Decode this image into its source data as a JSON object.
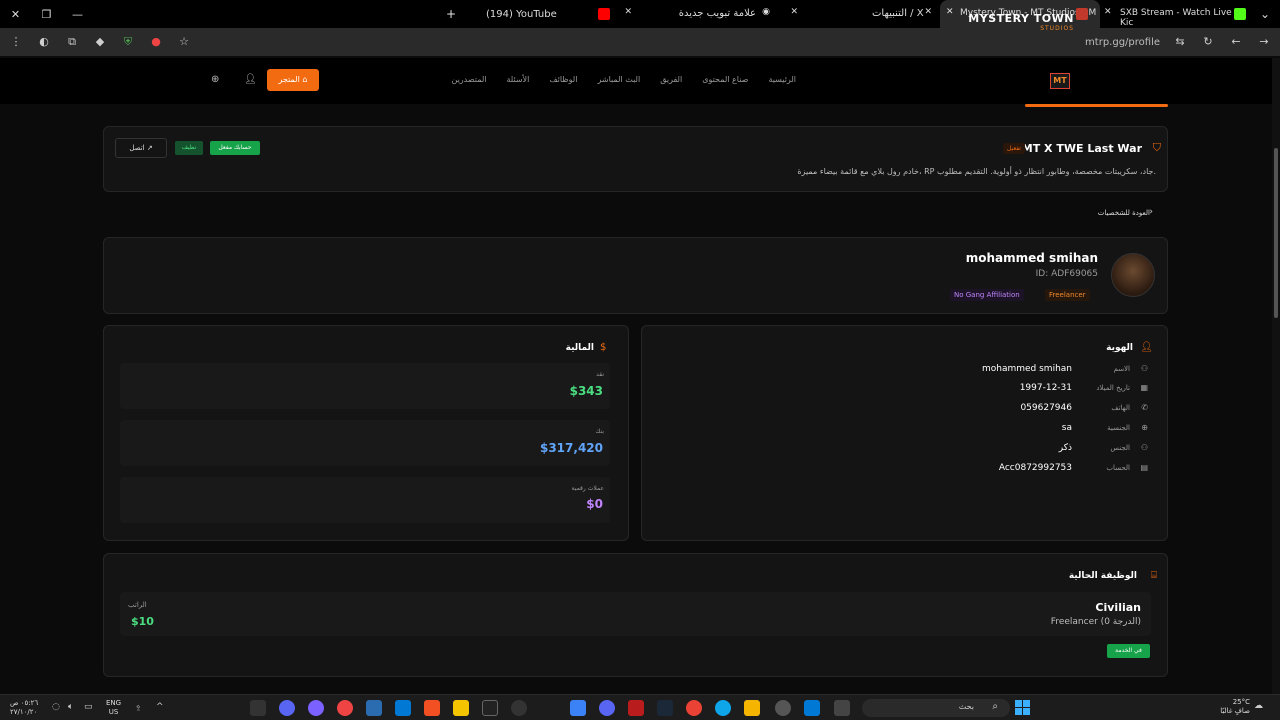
{
  "browser": {
    "tabs": [
      {
        "label": "",
        "icon": "new-tab"
      },
      {
        "label": "(194) YouTube",
        "icon": "youtube-icon",
        "color": "#ff0000"
      },
      {
        "label": "علامة تبويب جديدة",
        "icon": "chrome-icon"
      },
      {
        "label": "التنبيهات / X",
        "icon": "x-icon"
      },
      {
        "label": "Mystery Town - MT Studios | M",
        "icon": "mt-icon",
        "active": true
      },
      {
        "label": "SXB Stream - Watch Live on Kic",
        "icon": "kick-icon",
        "color": "#53fc18"
      }
    ],
    "url": "mtrp.gg/profile"
  },
  "site": {
    "logo_line1": "MYSTERY TOWN",
    "logo_line2": "STUDIOS",
    "logo_mark": "MT",
    "nav": [
      "الرئيسية",
      "صناع المحتوى",
      "الفريق",
      "البث المباشر",
      "الوظائف",
      "الأسئلة",
      "المتصدرين"
    ],
    "store_label": "المتجر",
    "accent": "#f26b10"
  },
  "announcement": {
    "title": "MT X TWE Last War",
    "badge": "تفعيل",
    "description": "خادم رول بلاي مع قائمة بيضاء مميزة، RP جاد، سكريبتات مخصصة، وطابور انتظار ذو أولوية. التقديم مطلوب.",
    "account_btn": "حسابك مفعل",
    "clean_btn": "نظيف",
    "connect_btn": "اتصل"
  },
  "back_link": "العودة للشخصيات",
  "profile": {
    "name": "mohammed smihan",
    "id": "ID: ADF69065",
    "tag_gang": "No Gang Affiliation",
    "tag_job": "Freelancer"
  },
  "identity": {
    "title": "الهوية",
    "rows": [
      {
        "label": "الاسم",
        "value": "mohammed smihan",
        "icon": "user-icon"
      },
      {
        "label": "تاريخ الميلاد",
        "value": "1997-12-31",
        "icon": "calendar-icon"
      },
      {
        "label": "الهاتف",
        "value": "059627946",
        "icon": "phone-icon"
      },
      {
        "label": "الجنسية",
        "value": "sa",
        "icon": "globe-icon"
      },
      {
        "label": "الجنس",
        "value": "ذكر",
        "icon": "person-icon"
      },
      {
        "label": "الحساب",
        "value": "Acc0872992753",
        "icon": "card-icon"
      }
    ]
  },
  "finance": {
    "title": "المالية",
    "cash_label": "نقد",
    "cash_value": "$343",
    "cash_color": "#4ade80",
    "bank_label": "بنك",
    "bank_value": "$317,420",
    "bank_color": "#60a5fa",
    "crypto_label": "عملات رقمية",
    "crypto_value": "$0",
    "crypto_color": "#c084fc"
  },
  "job": {
    "title": "الوظيفة الحالية",
    "name": "Civilian",
    "grade": "Freelancer (الدرجة 0)",
    "salary_label": "الراتب",
    "salary_value": "$10",
    "status": "في الخدمة"
  },
  "taskbar": {
    "time": "٠٥:٢٦ ص",
    "date": "٢٧/١٠/٢٠",
    "lang1": "ENG",
    "lang2": "US",
    "search_text": "بحث",
    "weather_temp": "25°C",
    "weather_text": "صافٍ غالبًا"
  }
}
